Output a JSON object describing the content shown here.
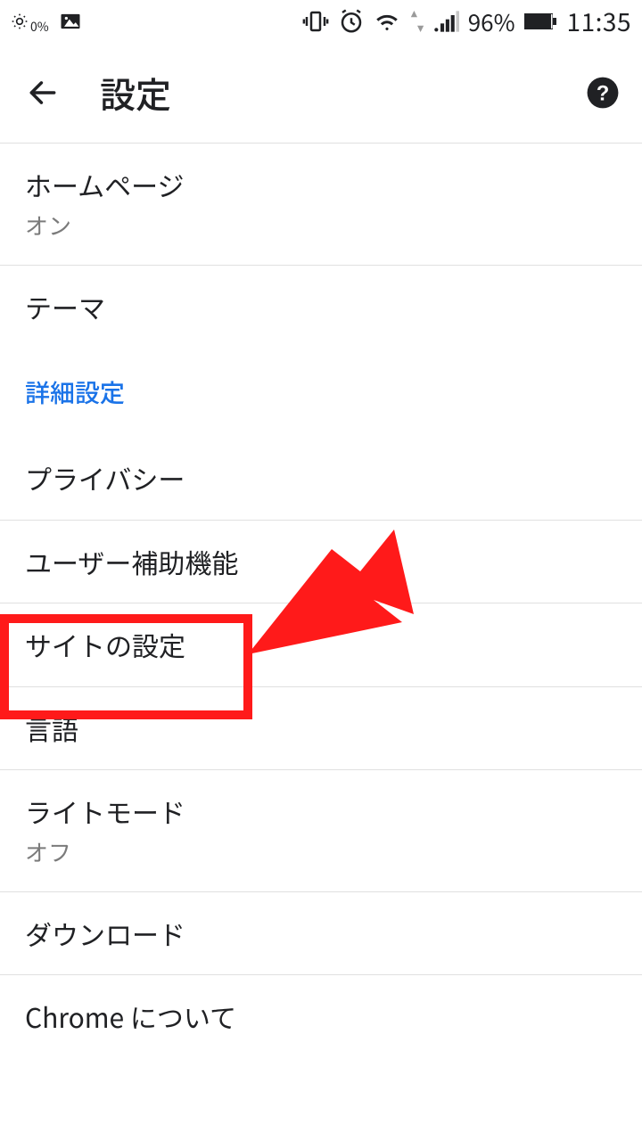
{
  "statusbar": {
    "brightness_pct": "0%",
    "battery_pct": "96%",
    "clock": "11:35"
  },
  "appbar": {
    "title": "設定"
  },
  "sections": {
    "advanced_header": "詳細設定"
  },
  "rows": {
    "homepage": {
      "label": "ホームページ",
      "status": "オン"
    },
    "theme": {
      "label": "テーマ"
    },
    "privacy": {
      "label": "プライバシー"
    },
    "accessibility": {
      "label": "ユーザー補助機能"
    },
    "site_settings": {
      "label": "サイトの設定"
    },
    "language": {
      "label": "言語"
    },
    "lite_mode": {
      "label": "ライトモード",
      "status": "オフ"
    },
    "downloads": {
      "label": "ダウンロード"
    },
    "about_chrome": {
      "label": "Chrome について"
    }
  }
}
